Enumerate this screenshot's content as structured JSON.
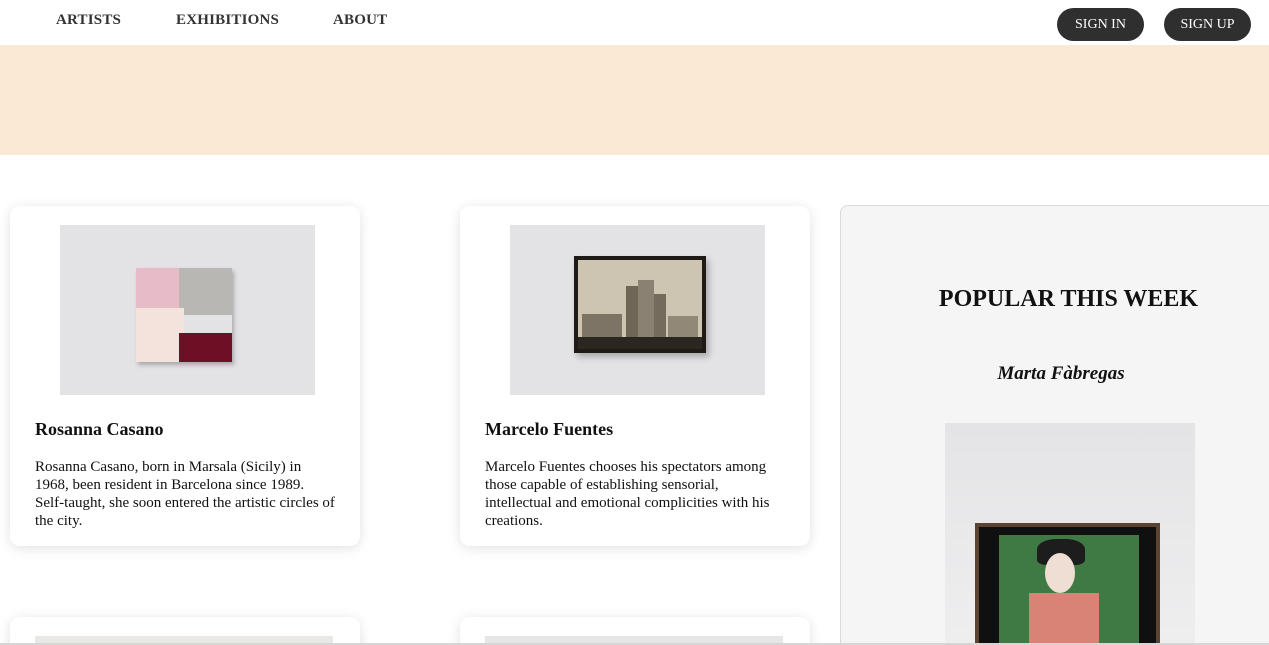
{
  "nav": {
    "links": [
      "ARTISTS",
      "EXHIBITIONS",
      "ABOUT"
    ],
    "sign_in": "SIGN IN",
    "sign_up": "SIGN UP"
  },
  "cards": [
    {
      "name": "Rosanna Casano",
      "description": "Rosanna Casano, born in Marsala (Sicily) in 1968, been resident in Barcelona since 1989. Self-taught, she soon entered the artistic circles of the city."
    },
    {
      "name": "Marcelo Fuentes",
      "description": "Marcelo Fuentes chooses his spectators among those capable of establishing sensorial, intellectual and emotional complicities with his creations."
    }
  ],
  "sidebar": {
    "title": "POPULAR THIS WEEK",
    "artist": "Marta Fàbregas"
  },
  "colors": {
    "hero": "#f9e9d5",
    "button": "#2f2f2f",
    "sidebar_bg": "#f5f5f5"
  }
}
